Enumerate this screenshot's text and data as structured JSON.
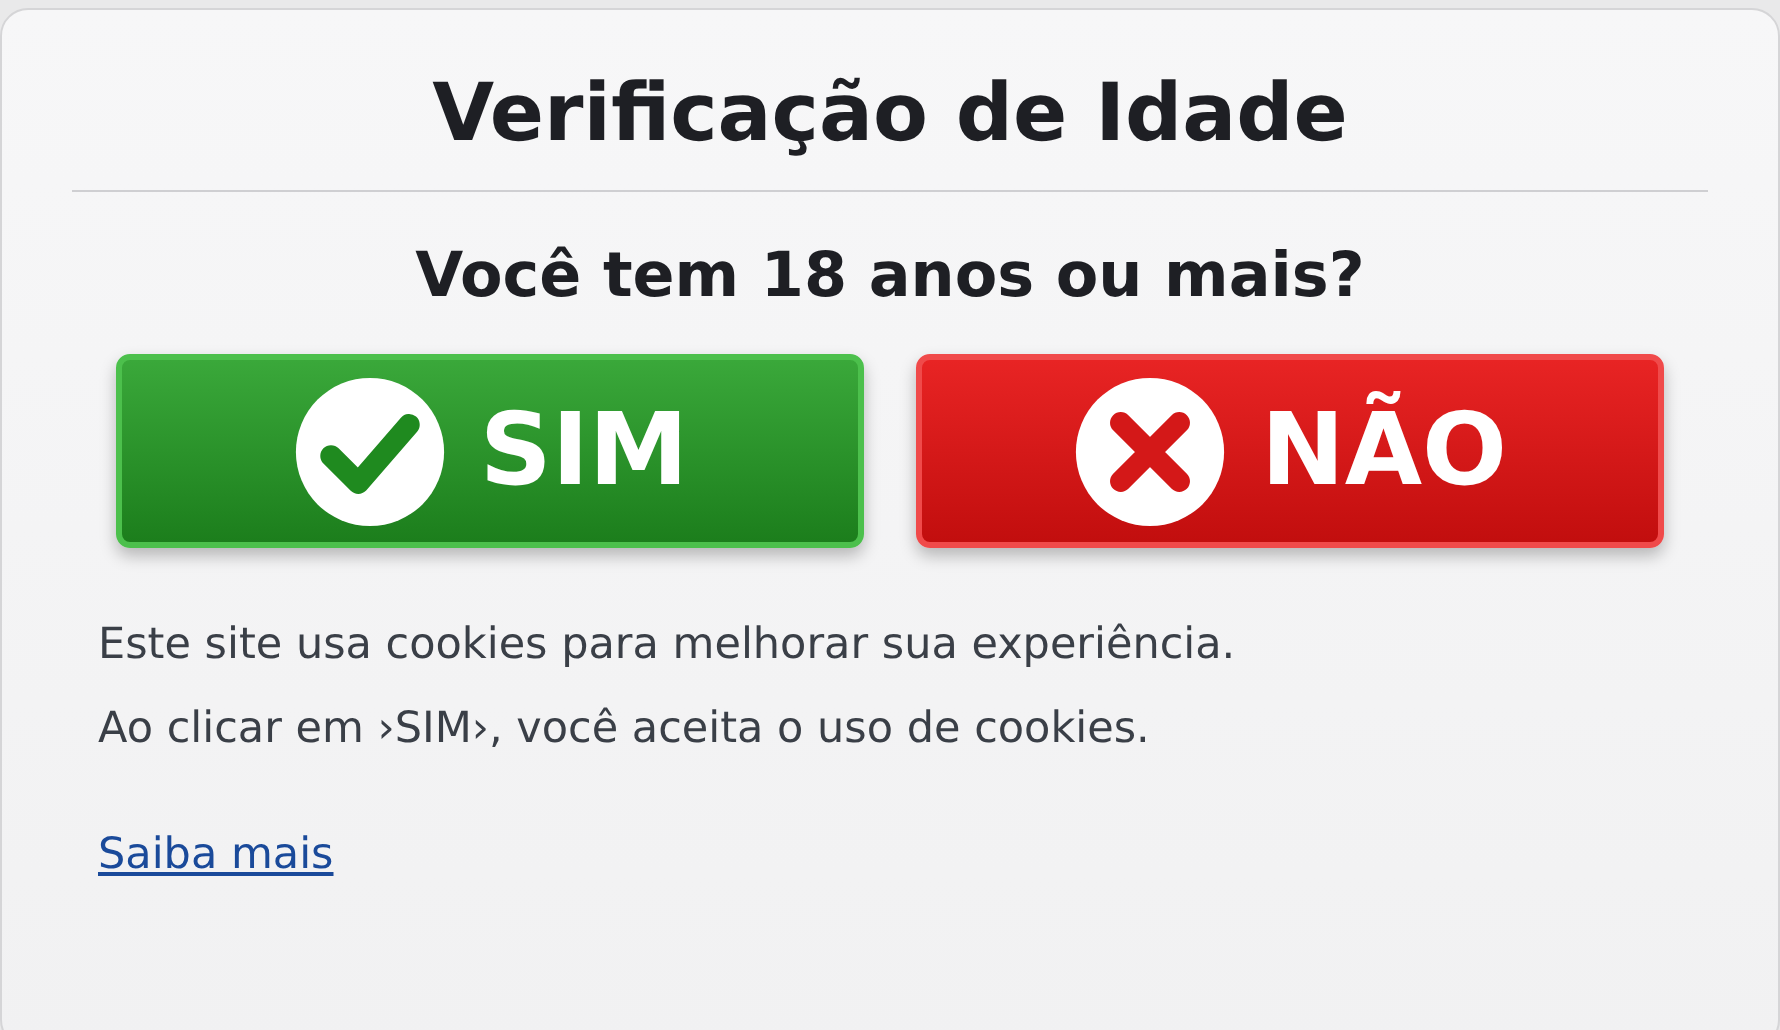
{
  "title": "Verificação de Idade",
  "question": "Você tem 18 anos ou mais?",
  "buttons": [
    {
      "label": "SIM",
      "kind": "confirm"
    },
    {
      "label": "NÃO",
      "kind": "decline"
    }
  ],
  "notice": [
    "Este site usa cookies para melhorar sua experiência.",
    "Ao clicar em ›SIM›, você aceita o uso de cookies."
  ],
  "link": "Saiba mais"
}
